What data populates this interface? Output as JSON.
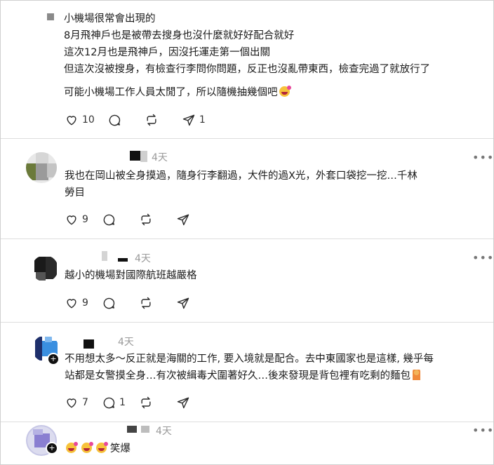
{
  "post": {
    "lines": [
      "小機場很常會出現的",
      "8月飛神戶也是被帶去搜身也沒什麼就好好配合就好",
      "這次12月也是飛神戶，因沒托運走第一個出關",
      "但這次沒被搜身，有檢查行李問你問題，反正也沒亂帶東西，檢查完過了就放行了"
    ],
    "last_line": "可能小機場工作人員太閒了，所以隨機抽幾個吧",
    "likes": "10",
    "comments": "",
    "reposts": "",
    "shares": "1"
  },
  "replies": [
    {
      "time": "4天",
      "text_lines": [
        "我也在岡山被全身摸過，隨身行李翻過，大件的過X光，外套口袋挖一挖…千林",
        "勞目"
      ],
      "likes": "9",
      "comments": "",
      "reposts": "",
      "shares": ""
    },
    {
      "time": "4天",
      "text_lines": [
        "越小的機場對國際航班越嚴格"
      ],
      "likes": "9",
      "comments": "",
      "reposts": "",
      "shares": ""
    },
    {
      "time": "4天",
      "text_lines": [
        "不用想太多～反正就是海關的工作, 要入境就是配合。去中東國家也是這樣, 幾乎每",
        "站都是女警摸全身…有次被緝毒犬圍著好久…後來發現是背包裡有吃剩的麵包"
      ],
      "likes": "7",
      "comments": "1",
      "reposts": "",
      "shares": ""
    },
    {
      "time": "4天",
      "text_lines": [
        "笑爆"
      ],
      "likes": "",
      "comments": "",
      "reposts": "",
      "shares": ""
    }
  ],
  "icons": {
    "like": "heart-icon",
    "comment": "comment-bubble-icon",
    "repost": "repost-arrows-icon",
    "share": "send-paper-plane-icon",
    "more": "more-dots-icon"
  },
  "more_glyph": "•••",
  "colors": {
    "text": "#1a1a1a",
    "muted": "#9a9a9a",
    "divider": "#dedede"
  }
}
